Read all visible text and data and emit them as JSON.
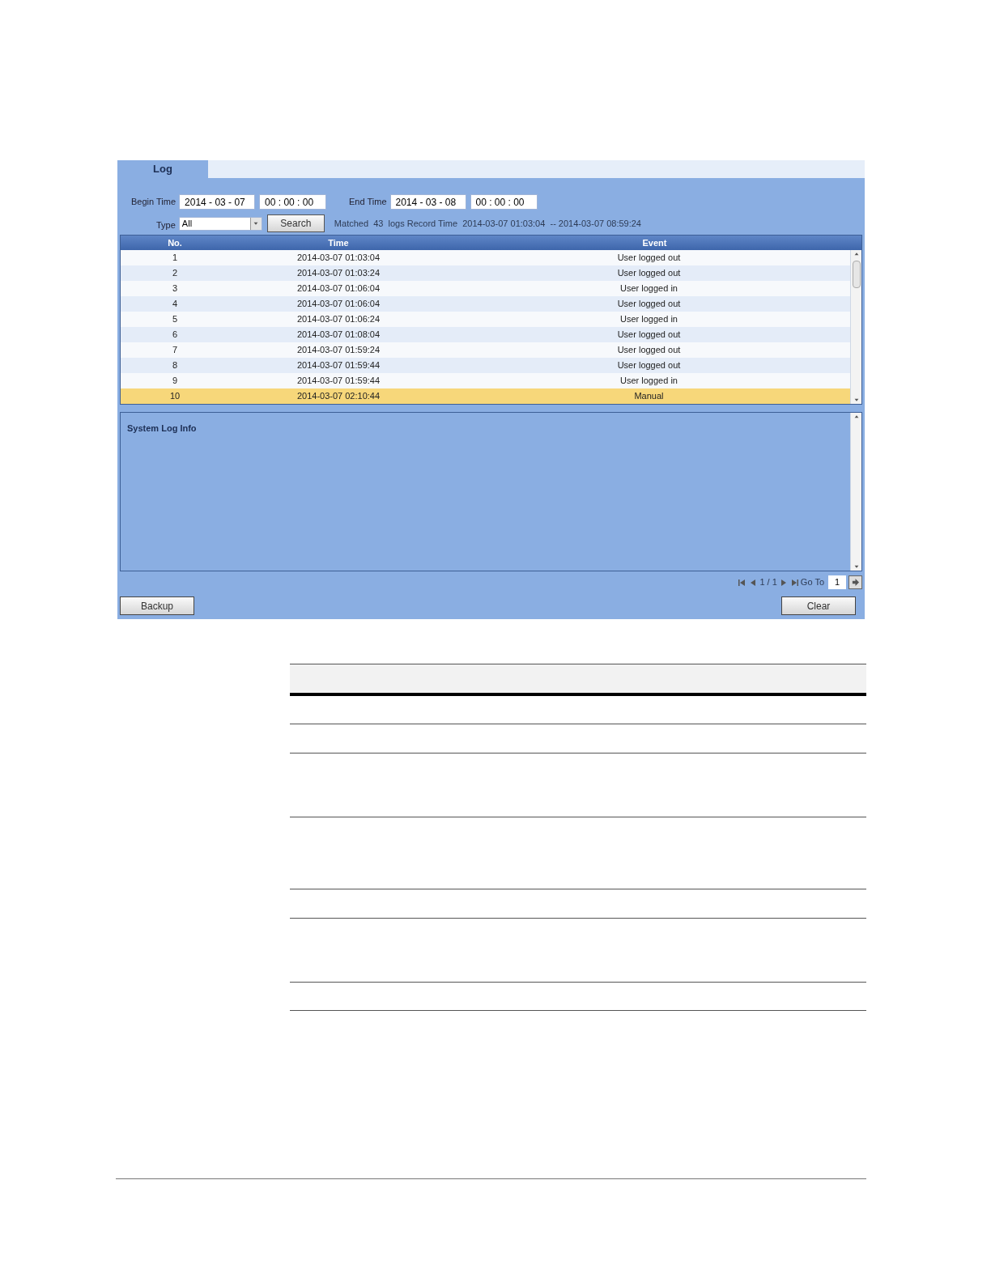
{
  "tabs": [
    {
      "label": "Log",
      "selected": true
    }
  ],
  "filters": {
    "begin_label": "Begin Time",
    "begin_date": "2014 - 03 - 07",
    "begin_time": "00 : 00 : 00",
    "end_label": "End Time",
    "end_date": "2014 - 03 - 08",
    "end_time": "00 : 00 : 00",
    "type_label": "Type",
    "type_value": "All",
    "search_button": "Search",
    "summary": "Matched  43  logs Record Time  2014-03-07 01:03:04  -- 2014-03-07 08:59:24"
  },
  "table": {
    "columns": [
      "No.",
      "Time",
      "Event"
    ],
    "rows": [
      {
        "no": "1",
        "time": "2014-03-07 01:03:04",
        "event": "User logged out",
        "selected": false
      },
      {
        "no": "2",
        "time": "2014-03-07 01:03:24",
        "event": "User logged out",
        "selected": false
      },
      {
        "no": "3",
        "time": "2014-03-07 01:06:04",
        "event": "User logged in",
        "selected": false
      },
      {
        "no": "4",
        "time": "2014-03-07 01:06:04",
        "event": "User logged out",
        "selected": false
      },
      {
        "no": "5",
        "time": "2014-03-07 01:06:24",
        "event": "User logged in",
        "selected": false
      },
      {
        "no": "6",
        "time": "2014-03-07 01:08:04",
        "event": "User logged out",
        "selected": false
      },
      {
        "no": "7",
        "time": "2014-03-07 01:59:24",
        "event": "User logged out",
        "selected": false
      },
      {
        "no": "8",
        "time": "2014-03-07 01:59:44",
        "event": "User logged out",
        "selected": false
      },
      {
        "no": "9",
        "time": "2014-03-07 01:59:44",
        "event": "User logged in",
        "selected": false
      },
      {
        "no": "10",
        "time": "2014-03-07 02:10:44",
        "event": "Manual",
        "selected": true
      }
    ]
  },
  "info_panel": {
    "title": "System Log Info"
  },
  "pagination": {
    "pages": "1 / 1",
    "goto_label": "Go To",
    "goto_value": "1"
  },
  "buttons": {
    "backup": "Backup",
    "clear": "Clear"
  }
}
